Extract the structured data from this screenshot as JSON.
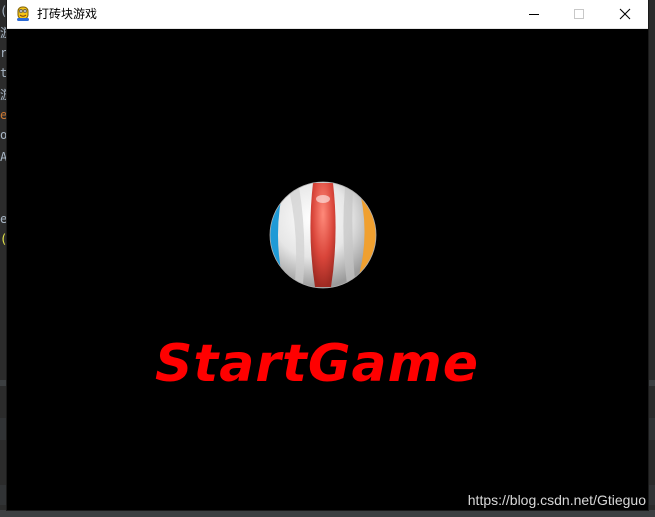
{
  "window": {
    "title": "打砖块游戏",
    "minimize_label": "minimize",
    "maximize_label": "maximize",
    "close_label": "close"
  },
  "game": {
    "start_text": "StartGame",
    "start_text_color": "#ff0000",
    "background_color": "#000000",
    "ball_icon": "beach-ball"
  },
  "background_editor": {
    "glyphs": [
      "(",
      "游",
      "r",
      "t",
      "游",
      "e",
      "o",
      "A",
      "e",
      "("
    ]
  },
  "watermark": {
    "text": "https://blog.csdn.net/Gtieguo"
  },
  "colors": {
    "titlebar": "#ffffff",
    "ball_red": "#d9453a",
    "ball_blue": "#1f9ad6",
    "ball_orange": "#f0a030",
    "ball_white": "#f2f2f2"
  }
}
